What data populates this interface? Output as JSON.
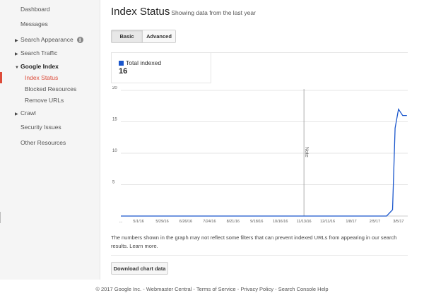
{
  "sidebar": {
    "dashboard": "Dashboard",
    "messages": "Messages",
    "search_appearance": "Search Appearance",
    "search_traffic": "Search Traffic",
    "google_index": "Google Index",
    "index_status": "Index Status",
    "blocked_resources": "Blocked Resources",
    "remove_urls": "Remove URLs",
    "crawl": "Crawl",
    "security_issues": "Security Issues",
    "other_resources": "Other Resources"
  },
  "header": {
    "title": "Index Status",
    "subtitle": "Showing data from the last year"
  },
  "view_toggle": {
    "basic": "Basic",
    "advanced": "Advanced",
    "selected": "Basic"
  },
  "legend": {
    "label": "Total indexed",
    "value": "16"
  },
  "chart_data": {
    "type": "line",
    "series": [
      {
        "name": "Total indexed",
        "color": "#1a56cc",
        "points": [
          {
            "x": "2016-04-10",
            "y": 0
          },
          {
            "x": "2017-02-05",
            "y": 0
          },
          {
            "x": "2017-02-12",
            "y": 0
          },
          {
            "x": "2017-02-19",
            "y": 0
          },
          {
            "x": "2017-02-26",
            "y": 1
          },
          {
            "x": "2017-03-01",
            "y": 14
          },
          {
            "x": "2017-03-05",
            "y": 17
          },
          {
            "x": "2017-03-10",
            "y": 16
          },
          {
            "x": "2017-03-15",
            "y": 16
          }
        ]
      }
    ],
    "x_start": "2016-04-10",
    "x_end": "2017-03-16",
    "x_tick_labels": [
      {
        "label": "...",
        "date": "2016-04-10"
      },
      {
        "label": "5/1/16",
        "date": "2016-05-01"
      },
      {
        "label": "5/29/16",
        "date": "2016-05-29"
      },
      {
        "label": "6/26/16",
        "date": "2016-06-26"
      },
      {
        "label": "7/24/16",
        "date": "2016-07-24"
      },
      {
        "label": "8/21/16",
        "date": "2016-08-21"
      },
      {
        "label": "9/18/16",
        "date": "2016-09-18"
      },
      {
        "label": "10/16/16",
        "date": "2016-10-16"
      },
      {
        "label": "11/13/16",
        "date": "2016-11-13"
      },
      {
        "label": "12/11/16",
        "date": "2016-12-11"
      },
      {
        "label": "1/8/17",
        "date": "2017-01-08"
      },
      {
        "label": "2/5/17",
        "date": "2017-02-05"
      },
      {
        "label": "3/5/17",
        "date": "2017-03-05"
      }
    ],
    "ylim": [
      0,
      20
    ],
    "y_ticks": [
      5,
      10,
      15,
      20
    ],
    "grid": true,
    "annotations": [
      {
        "date": "2016-11-13",
        "label": "Note"
      }
    ]
  },
  "note": {
    "text": "The numbers shown in the graph may not reflect some filters that can prevent indexed URLs from appearing in our search results.",
    "link": "Learn more."
  },
  "download_button": "Download chart data",
  "footer": {
    "copyright": "© 2017 Google Inc.",
    "links": [
      "Webmaster Central",
      "Terms of Service",
      "Privacy Policy",
      "Search Console Help"
    ],
    "separator": " - "
  }
}
